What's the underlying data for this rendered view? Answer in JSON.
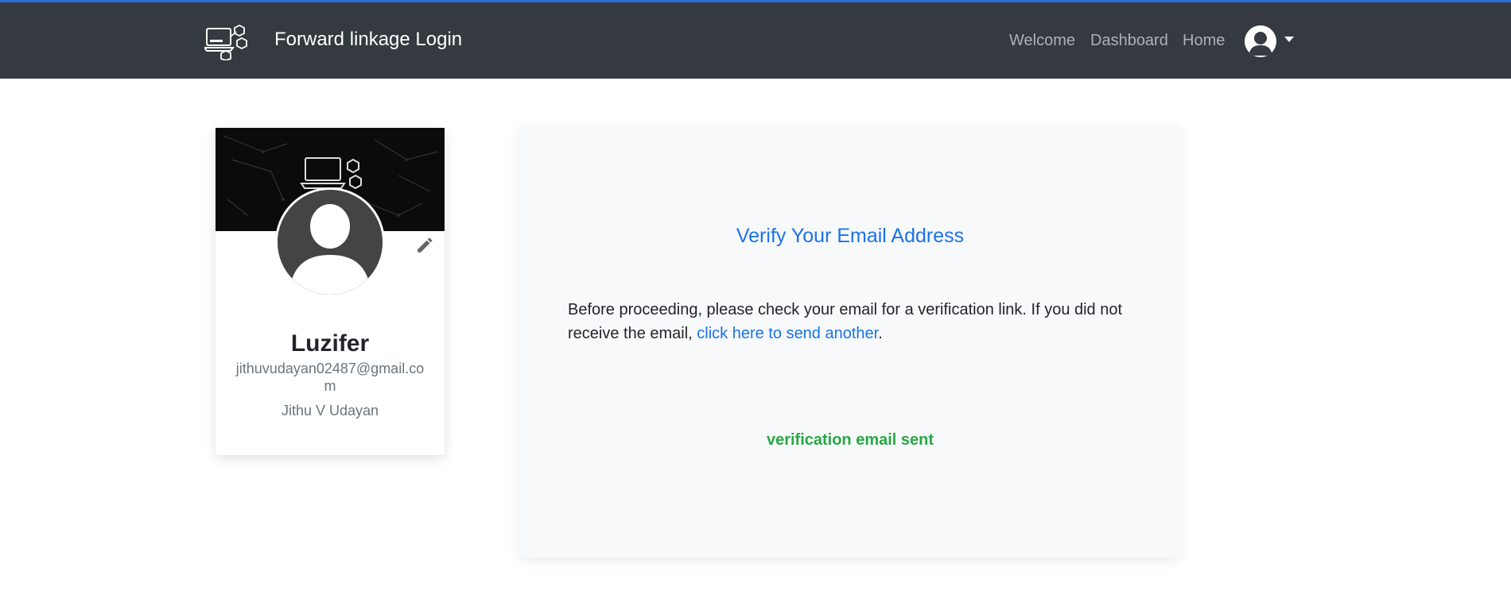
{
  "navbar": {
    "brand_title": "Forward linkage Login",
    "links": [
      "Welcome",
      "Dashboard",
      "Home"
    ],
    "bg_color": "#343a40"
  },
  "profile": {
    "name": "Luzifer",
    "email": "jithuvudayan02487@gmail.com",
    "full_name": "Jithu V Udayan"
  },
  "verify": {
    "title": "Verify Your Email Address",
    "text_before": "Before proceeding, please check your email for a verification link. If you did not receive the email, ",
    "link_text": "click here to send another",
    "text_after": ".",
    "status": "verification email sent",
    "accent_color": "#1a73e8",
    "success_color": "#28a745"
  }
}
